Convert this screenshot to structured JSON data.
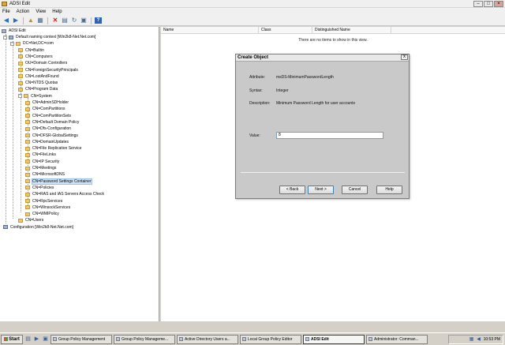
{
  "window": {
    "title": "ADSI Edit",
    "min_glyph": "–",
    "max_glyph": "□",
    "close_glyph": "×"
  },
  "menu": [
    "File",
    "Action",
    "View",
    "Help"
  ],
  "toolbar": {
    "icons": [
      "back-arrow",
      "forward-arrow",
      "up-folder",
      "show-hide-tree",
      "delete",
      "properties",
      "refresh",
      "export-list",
      "help"
    ],
    "help_glyph": "?"
  },
  "tree": {
    "root": "ADSI Edit",
    "items": [
      {
        "label": "Default naming context [Win2k8-Net.Net.com]",
        "level": 1,
        "expander": "-"
      },
      {
        "label": "DC=Net,DC=com",
        "level": 2,
        "expander": "-"
      },
      {
        "label": "CN=Builtin",
        "level": 3
      },
      {
        "label": "CN=Computers",
        "level": 3
      },
      {
        "label": "OU=Domain Controllers",
        "level": 3
      },
      {
        "label": "CN=ForeignSecurityPrincipals",
        "level": 3
      },
      {
        "label": "CN=LostAndFound",
        "level": 3
      },
      {
        "label": "CN=NTDS Quotas",
        "level": 3
      },
      {
        "label": "CN=Program Data",
        "level": 3
      },
      {
        "label": "CN=System",
        "level": 3,
        "expander": "-"
      },
      {
        "label": "CN=AdminSDHolder",
        "level": 4
      },
      {
        "label": "CN=ComPartitions",
        "level": 4
      },
      {
        "label": "CN=ComPartitionSets",
        "level": 4
      },
      {
        "label": "CN=Default Domain Policy",
        "level": 4
      },
      {
        "label": "CN=Dfs-Configuration",
        "level": 4
      },
      {
        "label": "CN=DFSR-GlobalSettings",
        "level": 4
      },
      {
        "label": "CN=DomainUpdates",
        "level": 4
      },
      {
        "label": "CN=File Replication Service",
        "level": 4
      },
      {
        "label": "CN=FileLinks",
        "level": 4
      },
      {
        "label": "CN=IP Security",
        "level": 4
      },
      {
        "label": "CN=Meetings",
        "level": 4
      },
      {
        "label": "CN=MicrosoftDNS",
        "level": 4
      },
      {
        "label": "CN=Password Settings Container",
        "level": 4,
        "selected": true
      },
      {
        "label": "CN=Policies",
        "level": 4
      },
      {
        "label": "CN=RAS and IAS Servers Access Check",
        "level": 4
      },
      {
        "label": "CN=RpcServices",
        "level": 4
      },
      {
        "label": "CN=WinsockServices",
        "level": 4
      },
      {
        "label": "CN=WMIPolicy",
        "level": 4
      },
      {
        "label": "CN=Users",
        "level": 3
      },
      {
        "label": "Configuration [Win2k8-Net.Net.com]",
        "level": 1
      }
    ]
  },
  "list": {
    "columns": [
      "Name",
      "Class",
      "Distinguished Name"
    ],
    "empty_message": "There are no items to show in this view."
  },
  "dialog": {
    "title": "Create Object",
    "close_glyph": "x",
    "attribute_label": "Attribute:",
    "attribute_value": "msDS-MinimumPasswordLength",
    "syntax_label": "Syntax:",
    "syntax_value": "Integer",
    "description_label": "Description:",
    "description_value": "Minimum Password Length for user accounts",
    "value_label": "Value:",
    "value_input": "8",
    "buttons": {
      "back": "< Back",
      "next": "Next >",
      "cancel": "Cancel",
      "help": "Help"
    }
  },
  "taskbar": {
    "start": "Start",
    "tasks": [
      {
        "label": "Group Policy Management",
        "active": false
      },
      {
        "label": "Group Policy Manageme...",
        "active": false
      },
      {
        "label": "Active Directory Users a...",
        "active": false
      },
      {
        "label": "Local Group Policy Editor",
        "active": false
      },
      {
        "label": "ADSI Edit",
        "active": true
      },
      {
        "label": "Administrator: Comman...",
        "active": false
      }
    ],
    "clock": "10:53 PM"
  }
}
